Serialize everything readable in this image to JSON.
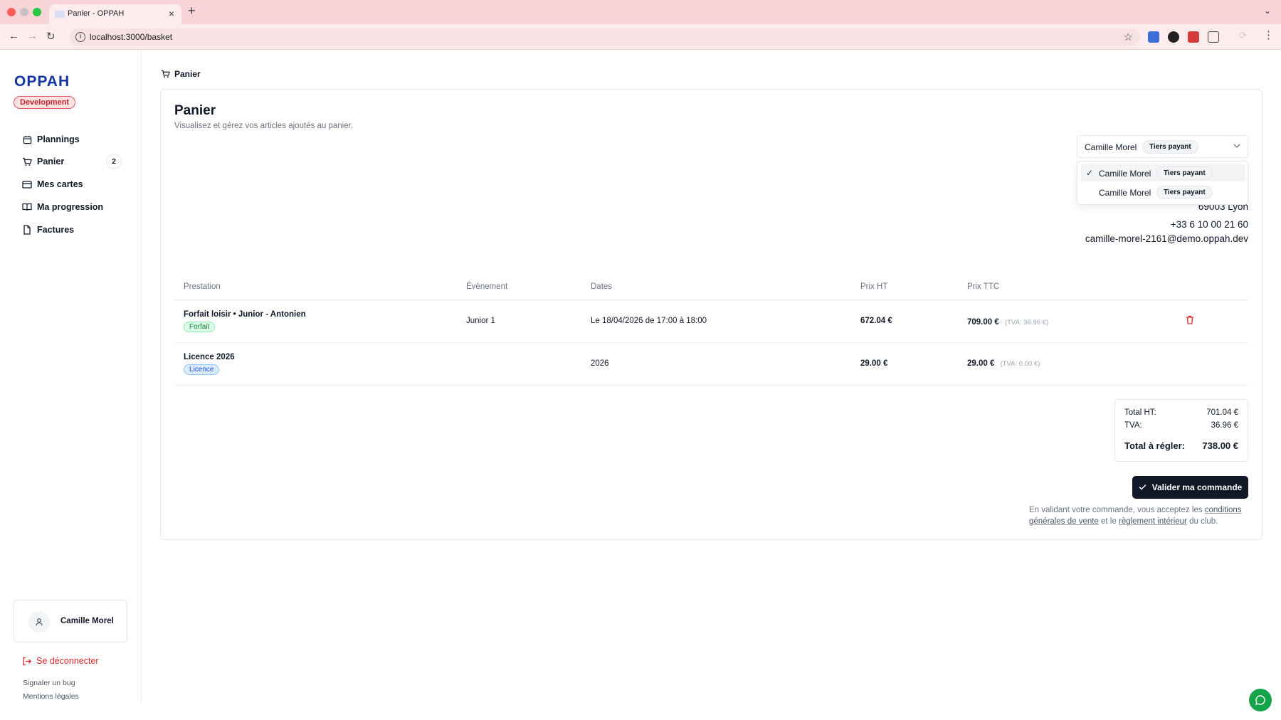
{
  "browser": {
    "tab_title": "Panier - OPPAH",
    "url": "localhost:3000/basket"
  },
  "sidebar": {
    "logo": "OPPAH",
    "environment": "Development",
    "items": [
      {
        "label": "Plannings",
        "icon": "calendar-icon"
      },
      {
        "label": "Panier",
        "icon": "cart-icon",
        "count": "2"
      },
      {
        "label": "Mes cartes",
        "icon": "card-icon"
      },
      {
        "label": "Ma progression",
        "icon": "book-icon"
      },
      {
        "label": "Factures",
        "icon": "file-icon"
      }
    ],
    "user_name": "Camille Morel",
    "logout_label": "Se déconnecter",
    "report_bug": "Signaler un bug",
    "legal": "Mentions légales"
  },
  "breadcrumb": "Panier",
  "page": {
    "title": "Panier",
    "subtitle": "Visualisez et gérez vos articles ajoutés au panier."
  },
  "payer_select": {
    "selected_name": "Camille Morel",
    "selected_tag": "Tiers payant",
    "options": [
      {
        "name": "Camille Morel",
        "tag": "Tiers payant",
        "selected": true
      },
      {
        "name": "Camille Morel",
        "tag": "Tiers payant",
        "selected": false
      }
    ]
  },
  "address": {
    "city": "69003 Lyon",
    "phone": "+33 6 10 00 21 60",
    "email": "camille-morel-2161@demo.oppah.dev"
  },
  "table": {
    "headers": [
      "Prestation",
      "Évènement",
      "Dates",
      "Prix HT",
      "Prix TTC"
    ],
    "rows": [
      {
        "name": "Forfait loisir • Junior - Antonien",
        "tag": "Forfait",
        "event": "Junior 1",
        "dates": "Le 18/04/2026 de 17:00 à 18:00",
        "prix_ht": "672.04 €",
        "prix_ttc": "709.00 €",
        "tva": "(TVA: 36.96 €)"
      },
      {
        "name": "Licence 2026",
        "tag": "Licence",
        "event": "",
        "dates": "2026",
        "prix_ht": "29.00 €",
        "prix_ttc": "29.00 €",
        "tva": "(TVA: 0.00 €)"
      }
    ]
  },
  "totals": {
    "ht_label": "Total HT:",
    "ht_value": "701.04 €",
    "tva_label": "TVA:",
    "tva_value": "36.96 €",
    "total_label": "Total à régler:",
    "total_value": "738.00 €"
  },
  "validate_label": "Valider ma commande",
  "terms": {
    "prefix": "En validant votre commande, vous acceptez les",
    "cgv": "conditions générales de vente",
    "middle": "et le",
    "reglement": "règlement intérieur",
    "suffix": "du club."
  },
  "colors": {
    "brand": "#1434a4",
    "primary_button": "#111827",
    "danger": "#dc2626",
    "chat": "#16a34a"
  }
}
